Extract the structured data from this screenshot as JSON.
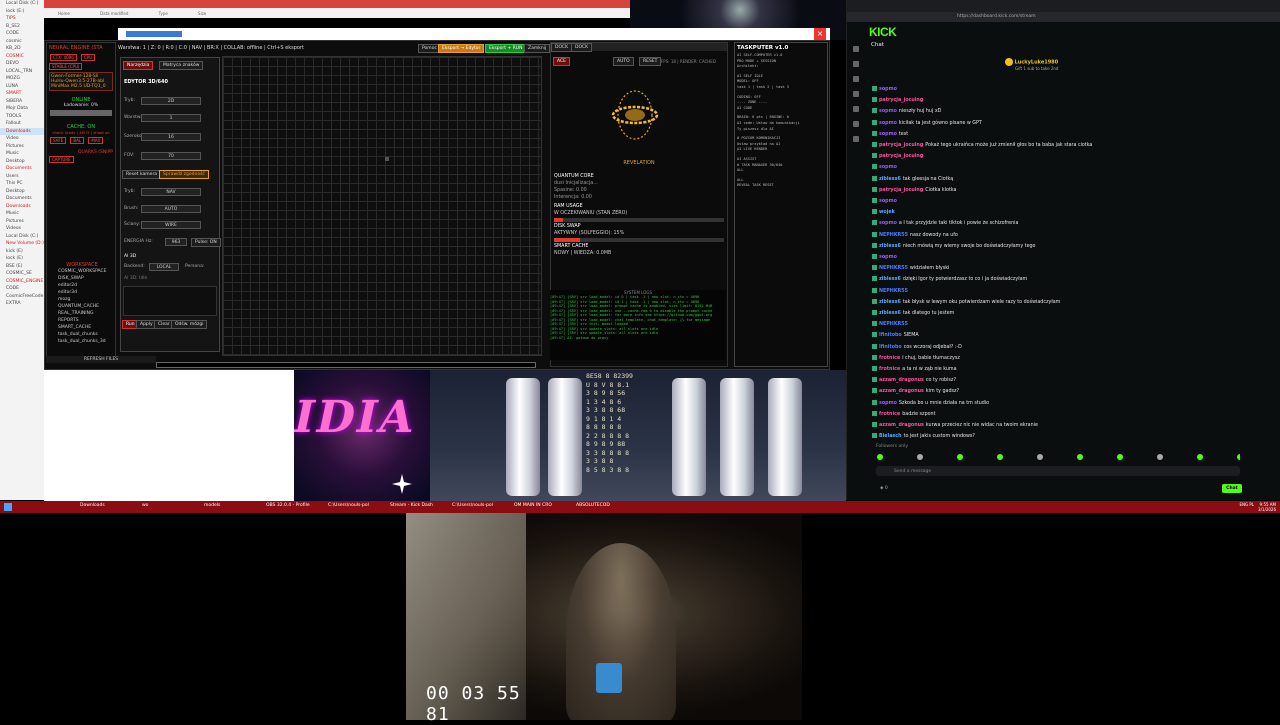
{
  "explorer": {
    "items": [
      "Local Disk (C:)",
      "lock (E:)",
      "TIPS",
      "B_SE2",
      "CODE",
      "cosmic",
      "KB_2D",
      "COSMIC",
      "DEVO",
      "LOCAL_TRN",
      "MOZG",
      "LUNA",
      "SMART",
      "SIBERA",
      "Mojr Data",
      "TOOLS",
      "Fallout",
      "Downloads",
      "Video",
      "Pictures",
      "Music",
      "Desktop",
      "Documents",
      "Users",
      "This PC",
      "Desktop",
      "Documents",
      "Downloads",
      "Music",
      "Pictures",
      "Videos",
      "Local Disk (C:)",
      "New Volume (D:)",
      "kick (E)",
      "lock (E)",
      "BSE (E)",
      "COSMIC_SE",
      "COSMIC_ENGINE",
      "CODE",
      "CosmicFreeCode",
      "EXTRA"
    ]
  },
  "browser": {
    "tabs": [
      "Local (C:)",
      "New Volume",
      "OH_MAIN",
      "Search Models"
    ],
    "bookmarks": [
      "Home",
      "Data modified",
      "Type",
      "Size"
    ]
  },
  "app": {
    "title": "ABSOLUTECODE — Edytor 3D",
    "neural": {
      "header": "NEURAL ENGINE (STA",
      "ctx": "CTX: 4096",
      "cpu": "CPU",
      "stable": "STABLE (CPU)",
      "models": [
        "Gwen-Former-128-Sli",
        "HuHu-Qwen3.5-27B-abl",
        "MiniMax M2.5 UD-TQ1_0"
      ],
      "online": "ONLINE",
      "loading": "Ładowanie: 0%",
      "cache": "CACHE: ON",
      "cache_detail": "check ready | 4M i5 | shoot ok",
      "buttons": [
        "SAFE",
        "BAL",
        "MAX"
      ],
      "quarks": "QUARKS (SNIPP",
      "capture": "CAPTURE"
    },
    "workspace": {
      "header": "WORKSPACE",
      "items": [
        "COSMIC_WORKSPACE",
        "DISK_SWAP",
        "editor2d",
        "editor3d",
        "mozg",
        "QUANTUM_CACHE",
        "REAL_TRAINING",
        "REPORTS",
        "SMART_CACHE",
        "task_dual_chunks",
        "task_dual_chunks_3d"
      ],
      "refresh": "REFRESH FILES"
    },
    "toolbar": {
      "text": "Warstwa: 1 | Z: 0 | R:0 | C:0 | NAV | BR:X | COLLAB: offline | Ctrl+S eksport",
      "help": "Pomoc",
      "export_edytor": "Eksport → Edytor",
      "export_run": "Eksport + RUN",
      "close": "Zamknij"
    },
    "editor": {
      "tab_tools": "Narzędzia",
      "tab_matrix": "Matryca znaków",
      "title": "EDYTOR 3D/640",
      "fields": [
        {
          "label": "Tryb:",
          "value": "2D"
        },
        {
          "label": "Warstwa:",
          "value": "1"
        },
        {
          "label": "Szerokość:",
          "value": "16"
        },
        {
          "label": "FOV:",
          "value": "70"
        }
      ],
      "reset_camera": "Reset kamera",
      "check_sync": "Sprawdź zgodność",
      "mode_label": "Tryb:",
      "mode_value": "NAV",
      "brush_label": "Brush:",
      "brush_value": "AUTO",
      "wall_label": "Ściany:",
      "wall_value": "WIRE",
      "energy_label": "ENERGIA Hz:",
      "energy_value": "963",
      "pulse": "Pulse: ON",
      "ai_label": "AI 3D",
      "backend_label": "Backend:",
      "backend_value": "LOCAL",
      "persona_label": "Persona:",
      "ai_status": "AI 3D: Idle",
      "buttons": [
        "Run",
        "Apply",
        "Clear",
        "Odśw. mózgi"
      ]
    },
    "revelation": {
      "tabs": [
        "DOCK",
        "DOCK"
      ],
      "actions": [
        "ACE",
        "AUTO",
        "RESET"
      ],
      "fps": "FPS: 18 | RENDER: CACHED",
      "caption": "REVELATION",
      "quantum_core": "QUANTUM CORE",
      "quantum_lines": [
        "dusi Inicjalizacja...",
        "Spasine: 0.00",
        "Interencja: 0.00"
      ],
      "ram": "RAM USAGE",
      "ram_status": "W OCZEKIWANIU (STAN ZERO)",
      "ram_pct": 0.05,
      "disk": "DISK SWAP",
      "disk_status": "AKTYWNY (SOLFEGGIO): 15%",
      "disk_pct": 0.15,
      "smart": "SMART CACHE",
      "smart_status": "NOWY | WIEDZA: 0.0MB",
      "logs_title": "SYSTEM LOGS",
      "logs": [
        "[09:47] [SRV] srv  load_model: id 0 | task -1 | new slot, n_ctx = 4096",
        "[09:47] [SRV] srv  load_model: id 1 | task -1 | new slot, n_ctx = 4096",
        "[09:47] [SRV] srv  load_model: prompt cache is enabled, size limit: 8192 MiB",
        "[09:47] [SRV] srv  load_model: use --cache-ram 0 to disable the prompt cache",
        "[09:47] [SRV] srv  load_model: for more info see https://github.com/ggml-org",
        "[09:47] [SRV] srv  load_model: chat template, chat_template: {% for message",
        "[09:47] [SRV] srv  init: model loaded",
        "[09:47] [SRV] srv  update_slots: all slots are idle",
        "[09:47] [SRV] srv  update_slots: all slots are idle",
        "[09:47] AI: gotowe do pracy"
      ]
    },
    "taskputer": {
      "title": "TASKPUTER v1.0",
      "lines": [
        "AI SELF-COMPUTER v1.0",
        "PRO MODE + SESSION",
        "Architekt:",
        "AI SELF IDLE",
        "MODEL: OFF",
        "task 1 | task 2 | task 3",
        "CODING: OFF",
        "---- ZONE ----",
        "AI CODE",
        "BRAIN: 0 pts | ENGINE: 0",
        "AI code: Ustaw da komunikacji",
        "Ty piszesz dla AI",
        "# POZIOM KOMUNIKACJI",
        "Ustaw przykład na AI",
        "AI LIVE RENDER",
        "AI ASSIST",
        "# TASK MANAGER 30/640",
        "ALL",
        "ALL",
        "REVEAL TASK RESET"
      ]
    }
  },
  "nvidia_text": "IDIA",
  "digits": [
    "8E58 8 82399",
    "U 8 V 8 8.1",
    "3 8 9 8 56",
    "1 3 4 8 6",
    "3 3 8 8 68",
    "9 1 8 1 4",
    "8 8 8 8 8",
    "2 2 8 8 8 8",
    "8 9 8 9 88",
    "3 3 8 8 8 8",
    "3 3 8 8",
    "8 5 8 3 8 8"
  ],
  "kick": {
    "url": "https://dashboard.kick.com/stream",
    "logo": "KICK",
    "chat_title": "Chat",
    "gift": {
      "user": "LuckyLuke1980",
      "text": "Gift 1 sub to take 2nd"
    },
    "followers_only": "Followers only",
    "input_placeholder": "Send a message",
    "chat_button": "Chat",
    "points": "0",
    "messages": [
      {
        "user": "sopmo",
        "color": "#9b59ff",
        "text": ""
      },
      {
        "user": "patrycja_jocuing",
        "color": "#ff4fa0",
        "text": ""
      },
      {
        "user": "sopmo",
        "color": "#9b59ff",
        "text": "nieszły huj huj xD"
      },
      {
        "user": "sopmo",
        "color": "#9b59ff",
        "text": "kiciłak ta jest gówno pisane w GPT"
      },
      {
        "user": "sopmo",
        "color": "#9b59ff",
        "text": "test"
      },
      {
        "user": "patrycja_jocuing",
        "color": "#ff4fa0",
        "text": "Pokaż tego ukraińca może już zmienił głos bo ta baba jak stara ciotka"
      },
      {
        "user": "patrycja_jocuing",
        "color": "#ff4fa0",
        "text": ""
      },
      {
        "user": "sopmo",
        "color": "#9b59ff",
        "text": ""
      },
      {
        "user": "zibless6",
        "color": "#5aa8ff",
        "text": "tak gleesja na Ciotką"
      },
      {
        "user": "patrycja_jocuing",
        "color": "#ff4fa0",
        "text": "Ciotka klotka"
      },
      {
        "user": "sopmo",
        "color": "#9b59ff",
        "text": ""
      },
      {
        "user": "wojek",
        "color": "#5aa8ff",
        "text": ""
      },
      {
        "user": "sopmo",
        "color": "#9b59ff",
        "text": "a I tak przyjdzie taki tiktok i powie że schizofrenia"
      },
      {
        "user": "NEPHKR55",
        "color": "#4c7dff",
        "text": "nasz dowody na ufo"
      },
      {
        "user": "zibless6",
        "color": "#5aa8ff",
        "text": "niech mówią my wiemy swoje bo doświadczyłamy tego"
      },
      {
        "user": "sopmo",
        "color": "#9b59ff",
        "text": ""
      },
      {
        "user": "NEPHKR55",
        "color": "#4c7dff",
        "text": "widziałem błyski"
      },
      {
        "user": "zibless6",
        "color": "#5aa8ff",
        "text": "dzięki Igor ty potwierdzasz to co i ja doświadczyłam"
      },
      {
        "user": "NEPHKR55",
        "color": "#4c7dff",
        "text": ""
      },
      {
        "user": "zibless6",
        "color": "#5aa8ff",
        "text": "tak błysk w lewym oku potwierdzam wiele razy to doświadczyłam"
      },
      {
        "user": "zibless6",
        "color": "#5aa8ff",
        "text": "tak dlatego tu jestem"
      },
      {
        "user": "NEPHKR55",
        "color": "#4c7dff",
        "text": ""
      },
      {
        "user": "Ifinitobo",
        "color": "#4c7dff",
        "text": "SIEMA"
      },
      {
        "user": "Ifinitobo",
        "color": "#4c7dff",
        "text": "cos wczoraj odjebał? :-D"
      },
      {
        "user": "frotnice",
        "color": "#ff4fa0",
        "text": "i chuj, babie tłumaczysz"
      },
      {
        "user": "frotnice",
        "color": "#ff4fa0",
        "text": "a ta ni w ząb nie kuma"
      },
      {
        "user": "azzam_dragonus",
        "color": "#ff4fa0",
        "text": "co ty robisz?"
      },
      {
        "user": "azzam_dragonus",
        "color": "#ff4fa0",
        "text": "kim ty gadsz?"
      },
      {
        "user": "sopmo",
        "color": "#9b59ff",
        "text": "Szkoda bo u mnie działa na tm studio"
      },
      {
        "user": "frotnice",
        "color": "#ff4fa0",
        "text": "badzie szpont"
      },
      {
        "user": "azzam_dragonus",
        "color": "#ff4fa0",
        "text": "kurwa przeciez nic nie widac na twoim ekranie"
      },
      {
        "user": "Bielasch",
        "color": "#5aa8ff",
        "text": "to jest jakis custom windows?"
      }
    ]
  },
  "taskbar": {
    "items": [
      "Downloads",
      "wo",
      "models",
      "OBS 32.0.4 - Profile",
      "C:\\Users\\nouls-pol",
      "Stream - Kick Dash",
      "C:\\Users\\nouls-pol",
      "OM MAIN IN CRO",
      "ABSOLUTECOD"
    ],
    "lang": "ENG PL",
    "time": "9:55 AM",
    "date": "3/1/2026"
  },
  "webcam_timer": "00 03 55 81"
}
